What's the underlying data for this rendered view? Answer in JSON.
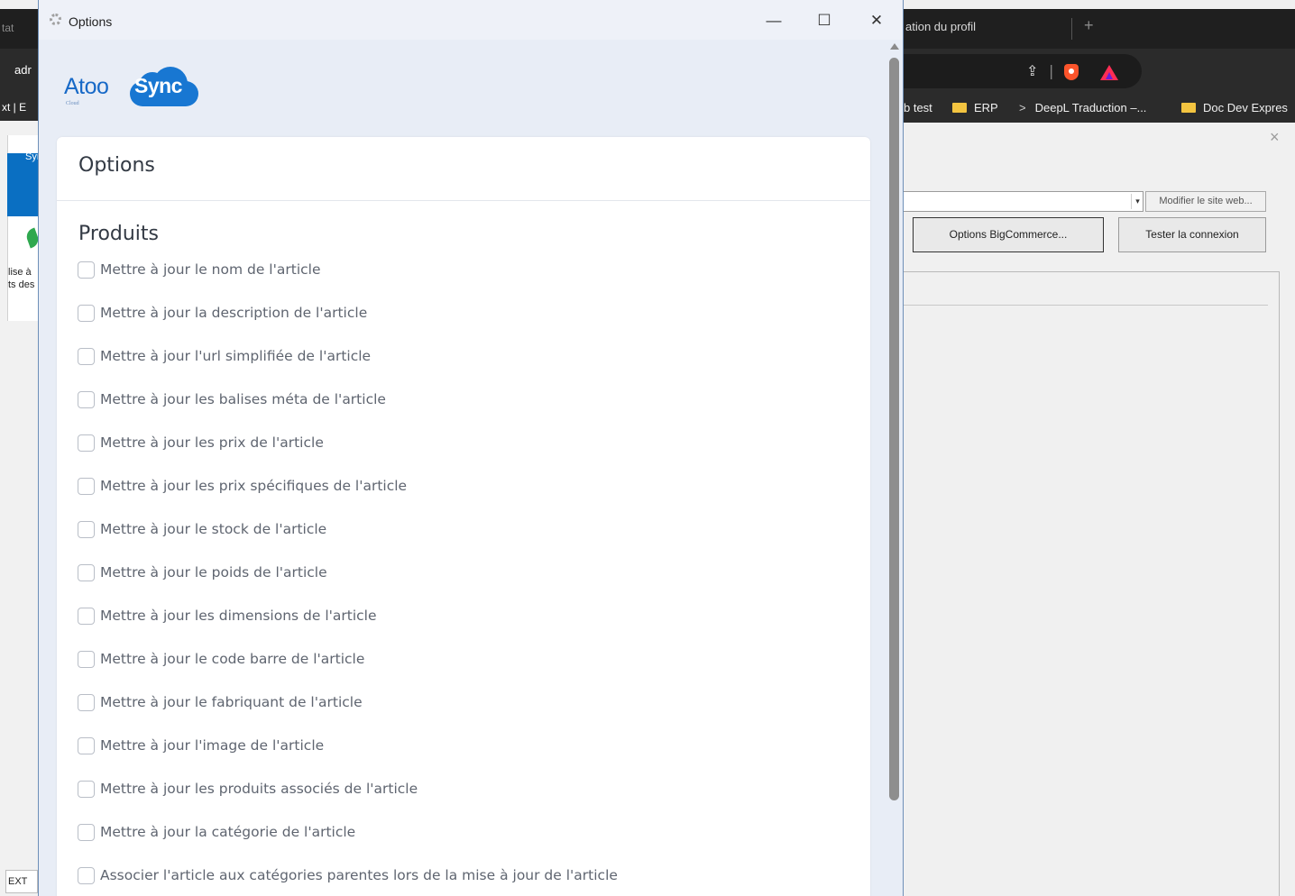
{
  "background_left": {
    "tab_fragment": "tat",
    "address_fragment": "adr",
    "bookmark_fragment": "xt | E",
    "panel_header_fragment": "Syn",
    "text_line_1": "lise à",
    "text_line_2": "ts des",
    "bottom_button": "EXT"
  },
  "background_browser": {
    "tab_label": "ation du profil",
    "tab_new": "+",
    "bookmarks": [
      {
        "label": "b test",
        "icon": "none"
      },
      {
        "label": "ERP",
        "icon": "folder-icon"
      },
      {
        "label": "DeepL Traduction –...",
        "icon": "chevron-icon"
      },
      {
        "label": "Doc Dev Expres",
        "icon": "folder-icon"
      }
    ],
    "dialog_close": "×",
    "modify_site_button": "Modifier le site web...",
    "options_button": "Options BigCommerce...",
    "test_connection_button": "Tester la connexion",
    "share_glyph": "⇪",
    "separator_glyph": "|"
  },
  "window": {
    "title": "Options",
    "minimize_glyph": "—",
    "maximize_glyph": "☐",
    "close_glyph": "✕"
  },
  "logo": {
    "text_left": "Atoo",
    "text_right": "Sync",
    "sub": "Cloud",
    "brand_color": "#1769c7"
  },
  "card": {
    "title": "Options",
    "section_title": "Produits",
    "options": [
      {
        "label": "Mettre à jour le nom de l'article",
        "checked": false
      },
      {
        "label": "Mettre à jour la description de l'article",
        "checked": false
      },
      {
        "label": "Mettre à jour l'url simplifiée de l'article",
        "checked": false
      },
      {
        "label": "Mettre à jour les balises méta de l'article",
        "checked": false
      },
      {
        "label": "Mettre à jour les prix de l'article",
        "checked": false
      },
      {
        "label": "Mettre à jour les prix spécifiques de l'article",
        "checked": false
      },
      {
        "label": "Mettre à jour le stock de l'article",
        "checked": false
      },
      {
        "label": "Mettre à jour le poids de l'article",
        "checked": false
      },
      {
        "label": "Mettre à jour les dimensions de l'article",
        "checked": false
      },
      {
        "label": "Mettre à jour le code barre de l'article",
        "checked": false
      },
      {
        "label": "Mettre à jour le fabriquant de l'article",
        "checked": false
      },
      {
        "label": "Mettre à jour l'image de l'article",
        "checked": false
      },
      {
        "label": "Mettre à jour les produits associés de l'article",
        "checked": false
      },
      {
        "label": "Mettre à jour la catégorie de l'article",
        "checked": false
      },
      {
        "label": "Associer l'article aux catégories parentes lors de la mise à jour de l'article",
        "checked": false
      }
    ]
  }
}
